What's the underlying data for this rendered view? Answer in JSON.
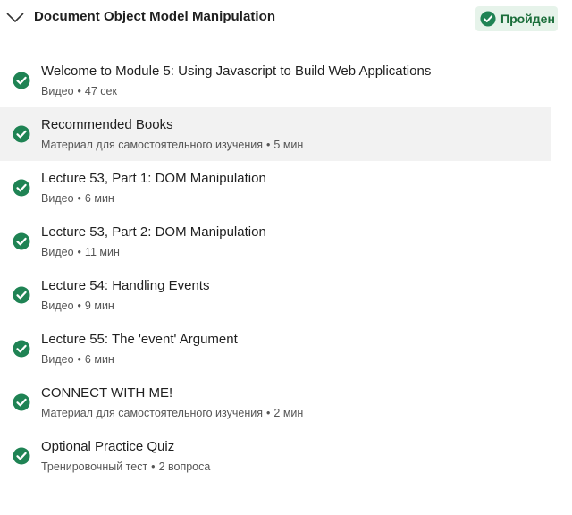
{
  "module": {
    "title": "Document Object Model Manipulation",
    "status": "Пройден",
    "status_color": "#1a6e3a",
    "status_bg": "#e6f3ea",
    "collapse_icon": "chevron-down-icon"
  },
  "items": [
    {
      "title": "Welcome to Module 5: Using Javascript to Build Web Applications",
      "type": "Видео",
      "duration": "47 сек",
      "completed": true,
      "icon": "check-circle-icon"
    },
    {
      "title": "Recommended Books",
      "type": "Материал для самостоятельного изучения",
      "duration": "5 мин",
      "completed": true,
      "icon": "check-circle-icon"
    },
    {
      "title": "Lecture 53, Part 1: DOM Manipulation",
      "type": "Видео",
      "duration": "6 мин",
      "completed": true,
      "icon": "check-circle-icon"
    },
    {
      "title": "Lecture 53, Part 2: DOM Manipulation",
      "type": "Видео",
      "duration": "11 мин",
      "completed": true,
      "icon": "check-circle-icon"
    },
    {
      "title": "Lecture 54: Handling Events",
      "type": "Видео",
      "duration": "9 мин",
      "completed": true,
      "icon": "check-circle-icon"
    },
    {
      "title": "Lecture 55: The 'event' Argument",
      "type": "Видео",
      "duration": "6 мин",
      "completed": true,
      "icon": "check-circle-icon"
    },
    {
      "title": "CONNECT WITH ME!",
      "type": "Материал для самостоятельного изучения",
      "duration": "2 мин",
      "completed": true,
      "icon": "check-circle-icon"
    },
    {
      "title": "Optional Practice Quiz",
      "type": "Тренировочный тест",
      "duration": "2 вопроса",
      "completed": true,
      "icon": "check-circle-icon"
    }
  ],
  "colors": {
    "check_green": "#1f8354",
    "highlight_bg": "#f2f2f2",
    "divider": "#bdbdbd"
  }
}
